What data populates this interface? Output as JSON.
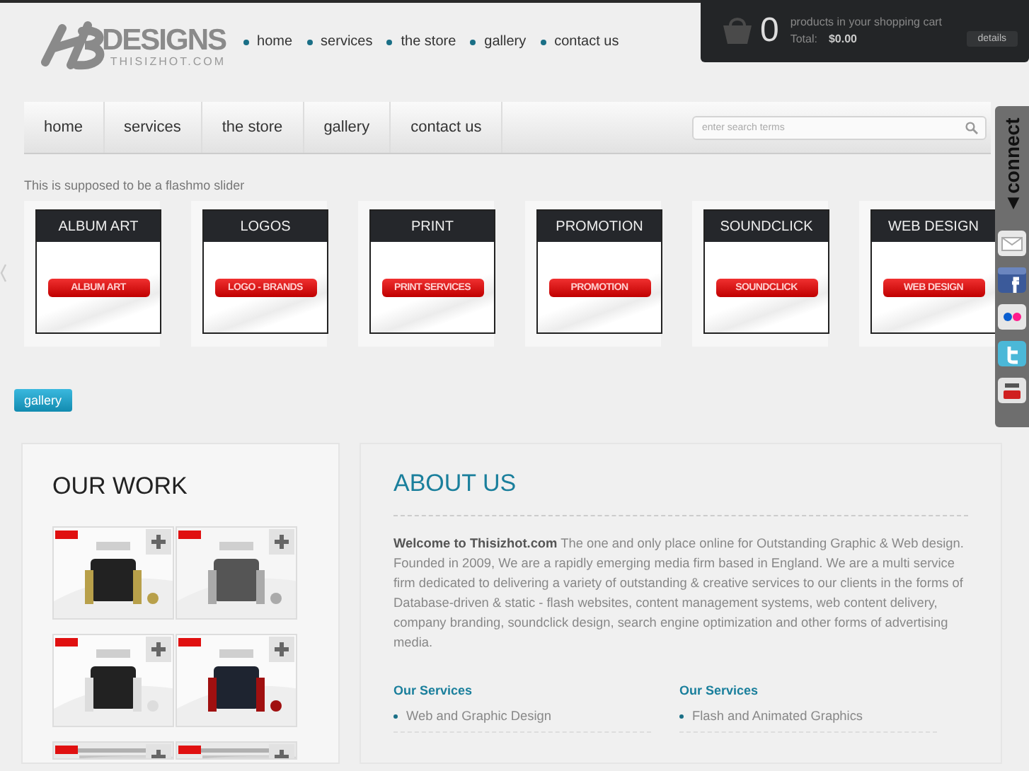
{
  "logo": {
    "wordmark": "DESIGNS",
    "tagline": "THISIZHOT.COM"
  },
  "top_nav": [
    "home",
    "services",
    "the store",
    "gallery",
    "contact us"
  ],
  "cart": {
    "count": "0",
    "caption": "products in your shopping cart",
    "total_label": "Total:",
    "total": "$0.00",
    "button": "details"
  },
  "main_nav": [
    "home",
    "services",
    "the store",
    "gallery",
    "contact us"
  ],
  "search": {
    "placeholder": "enter search terms"
  },
  "slider": {
    "caption": "This is supposed to be a flashmo slider",
    "items": [
      {
        "title": "ALBUM ART",
        "label": "ALBUM ART"
      },
      {
        "title": "LOGOS",
        "label": "LOGO - BRANDS"
      },
      {
        "title": "PRINT",
        "label": "PRINT SERVICES"
      },
      {
        "title": "PROMOTION",
        "label": "PROMOTION"
      },
      {
        "title": "SOUNDCLICK",
        "label": "SOUNDCLICK"
      },
      {
        "title": "WEB DESIGN",
        "label": "WEB DESIGN"
      }
    ]
  },
  "gallery_button": "gallery",
  "our_work": {
    "title": "OUR WORK"
  },
  "about": {
    "title": "ABOUT US",
    "intro": "**Welcome to Thisizhot.com** The one and only place online for Outstanding Graphic & Web design. Founded in 2009, We are a rapidly emerging media firm based in England. We are a multi service firm dedicated to delivering a variety of outstanding & creative services to our clients in the forms of Database-driven & static - flash websites, content management systems, web content delivery, company branding, soundclick design, search engine optimization and other forms of advertising media.",
    "service_columns": [
      {
        "heading": "Our Services",
        "items": [
          "Web and Graphic Design"
        ]
      },
      {
        "heading": "Our Services",
        "items": [
          "Flash and Animated Graphics"
        ]
      }
    ]
  },
  "connect": {
    "label": "◄connect",
    "icons": [
      {
        "kind": "mail"
      },
      {
        "kind": "facebook"
      },
      {
        "kind": "flickr"
      },
      {
        "kind": "twitter"
      },
      {
        "kind": "youtube"
      }
    ]
  }
}
